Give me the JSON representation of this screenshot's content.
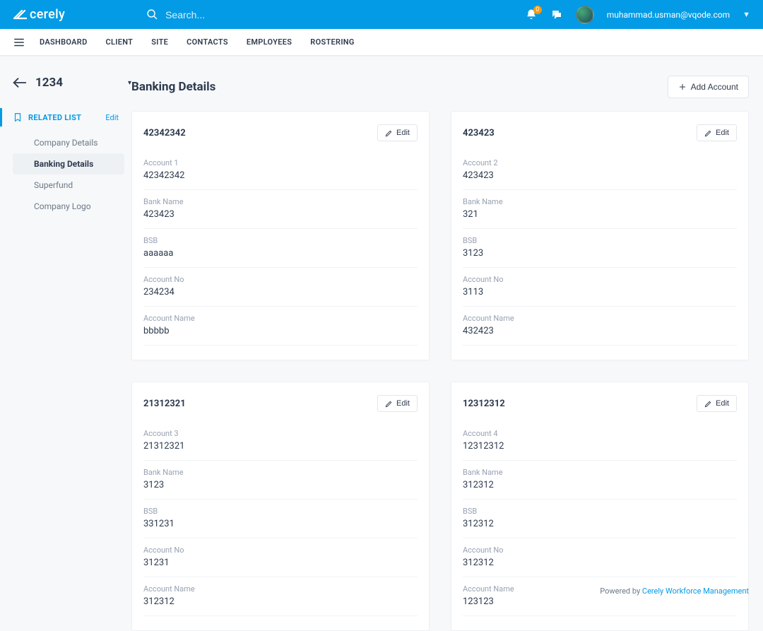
{
  "brand": "cerely",
  "search": {
    "placeholder": "Search..."
  },
  "user": {
    "email": "muhammad.usman@vqode.com",
    "notifications": "0"
  },
  "nav": [
    "DASHBOARD",
    "CLIENT",
    "SITE",
    "CONTACTS",
    "EMPLOYEES",
    "ROSTERING"
  ],
  "entity_id": "1234",
  "related": {
    "label": "RELATED LIST",
    "edit": "Edit",
    "items": [
      "Company Details",
      "Banking Details",
      "Superfund",
      "Company Logo"
    ],
    "active_index": 1
  },
  "page_title": "Banking Details",
  "add_label": "Add Account",
  "edit_label": "Edit",
  "field_labels": {
    "bank_name": "Bank Name",
    "bsb": "BSB",
    "acc_no": "Account No",
    "acc_name": "Account Name"
  },
  "accounts": [
    {
      "title": "42342342",
      "account_label": "Account 1",
      "account_value": "42342342",
      "bank_name": "423423",
      "bsb": "aaaaaa",
      "acc_no": "234234",
      "acc_name": "bbbbb"
    },
    {
      "title": "423423",
      "account_label": "Account 2",
      "account_value": "423423",
      "bank_name": "321",
      "bsb": "3123",
      "acc_no": "3113",
      "acc_name": "432423"
    },
    {
      "title": "21312321",
      "account_label": "Account 3",
      "account_value": "21312321",
      "bank_name": "3123",
      "bsb": "331231",
      "acc_no": "31231",
      "acc_name": "312312"
    },
    {
      "title": "12312312",
      "account_label": "Account 4",
      "account_value": "12312312",
      "bank_name": "312312",
      "bsb": "312312",
      "acc_no": "312312",
      "acc_name": "123123"
    }
  ],
  "footer": {
    "prefix": "Powered by ",
    "link": "Cerely Workforce Management"
  }
}
